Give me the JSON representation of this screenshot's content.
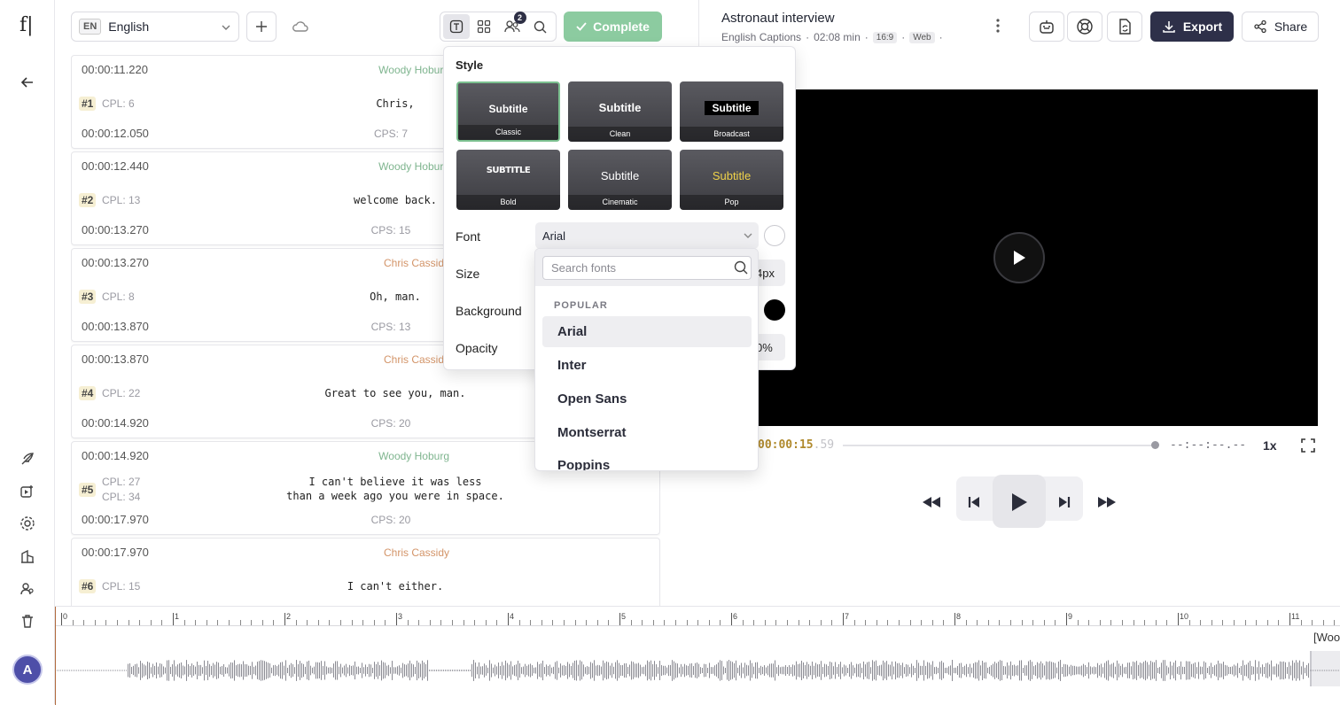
{
  "app": {
    "logo": "f|"
  },
  "toolbar": {
    "language_code": "EN",
    "language": "English",
    "speakers_badge": "2",
    "complete_label": "Complete"
  },
  "subtitles": [
    {
      "start": "00:00:11.220",
      "end": "00:00:12.050",
      "speaker": "Woody Hoburg",
      "speaker_color": "#7fb58f",
      "num": "#1",
      "cpl": [
        "CPL: 6"
      ],
      "lines": [
        "Chris,"
      ],
      "cps": "CPS: 7"
    },
    {
      "start": "00:00:12.440",
      "end": "00:00:13.270",
      "speaker": "Woody Hoburg",
      "speaker_color": "#7fb58f",
      "num": "#2",
      "cpl": [
        "CPL: 13"
      ],
      "lines": [
        "welcome back."
      ],
      "cps": "CPS: 15"
    },
    {
      "start": "00:00:13.270",
      "end": "00:00:13.870",
      "speaker": "Chris Cassidy",
      "speaker_color": "#d39468",
      "num": "#3",
      "cpl": [
        "CPL: 8"
      ],
      "lines": [
        "Oh, man."
      ],
      "cps": "CPS: 13"
    },
    {
      "start": "00:00:13.870",
      "end": "00:00:14.920",
      "speaker": "Chris Cassidy",
      "speaker_color": "#d39468",
      "num": "#4",
      "cpl": [
        "CPL: 22"
      ],
      "lines": [
        "Great to see you, man."
      ],
      "cps": "CPS: 20"
    },
    {
      "start": "00:00:14.920",
      "end": "00:00:17.970",
      "speaker": "Woody Hoburg",
      "speaker_color": "#7fb58f",
      "num": "#5",
      "cpl": [
        "CPL: 27",
        "CPL: 34"
      ],
      "lines": [
        "I can't believe it was less",
        "than a week ago you were in space."
      ],
      "cps": "CPS: 20"
    },
    {
      "start": "00:00:17.970",
      "end": "",
      "speaker": "Chris Cassidy",
      "speaker_color": "#d39468",
      "num": "#6",
      "cpl": [
        "CPL: 15"
      ],
      "lines": [
        "I can't either."
      ],
      "cps": ""
    }
  ],
  "style_panel": {
    "heading": "Style",
    "presets": [
      {
        "sample": "Subtitle",
        "name": "Classic",
        "selected": true
      },
      {
        "sample": "Subtitle",
        "name": "Clean",
        "selected": false
      },
      {
        "sample": "Subtitle",
        "name": "Broadcast",
        "selected": false
      },
      {
        "sample": "SUBTITLE",
        "name": "Bold",
        "selected": false
      },
      {
        "sample": "Subtitle",
        "name": "Cinematic",
        "selected": false
      },
      {
        "sample": "Subtitle",
        "name": "Pop",
        "selected": false
      }
    ],
    "font_label": "Font",
    "font_value": "Arial",
    "size_label": "Size",
    "size_value_peek": "4px",
    "background_label": "Background",
    "opacity_label": "Opacity",
    "opacity_value_peek": "0%"
  },
  "font_dropdown": {
    "search_placeholder": "Search fonts",
    "category": "POPULAR",
    "options": [
      "Arial",
      "Inter",
      "Open Sans",
      "Montserrat",
      "Poppins"
    ]
  },
  "project": {
    "title": "Astronaut interview",
    "captions": "English Captions",
    "duration": "02:08 min",
    "aspect": "16:9",
    "platform": "Web",
    "export_label": "Export",
    "share_label": "Share"
  },
  "player": {
    "time_main": "00:00:15",
    "time_ms": ".59",
    "end_time": "--:--:--.--",
    "speed": "1x"
  },
  "timeline": {
    "labels": [
      "0",
      "1",
      "2",
      "3",
      "4",
      "5",
      "6",
      "7",
      "8",
      "9",
      "10",
      "11"
    ],
    "clip_label": "[Woo"
  },
  "user": {
    "initial": "A"
  }
}
